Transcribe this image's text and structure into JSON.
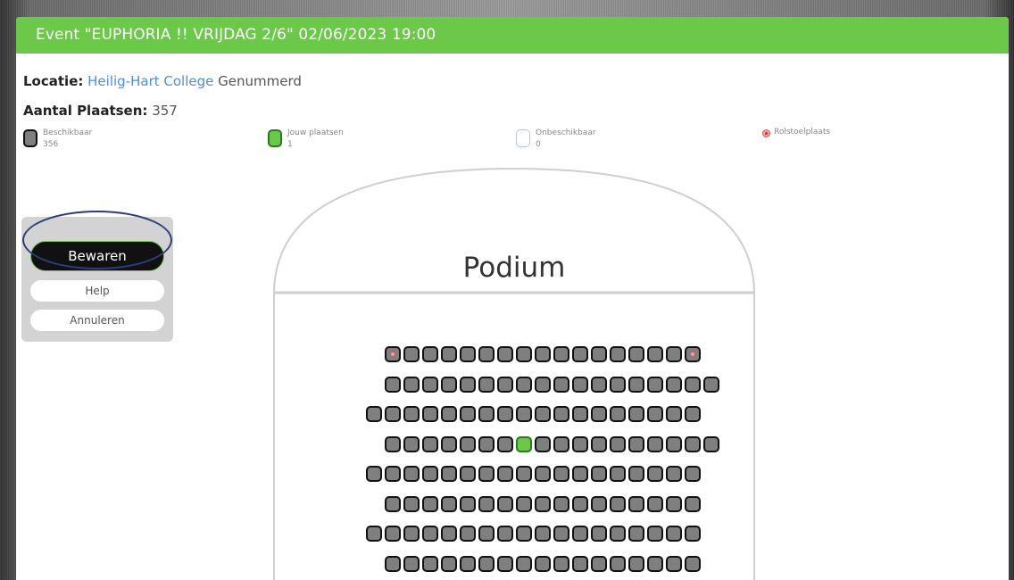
{
  "window": {
    "title": "Event \"EUPHORIA !! VRIJDAG 2/6\" 02/06/2023 19:00"
  },
  "info": {
    "locatie_label": "Locatie:",
    "locatie_link": "Heilig-Hart College",
    "locatie_suffix": "Genummerd",
    "plaatsen_label": "Aantal Plaatsen:",
    "plaatsen_value": "357"
  },
  "legend": {
    "beschikbaar": {
      "label": "Beschikbaar",
      "count": "356",
      "color": "#7f7f7f"
    },
    "jouw": {
      "label": "Jouw plaatsen",
      "count": "1",
      "color": "#6bc849"
    },
    "onbeschikbaar": {
      "label": "Onbeschikbaar",
      "count": "0",
      "color": "#ffffff"
    },
    "rolstoel": {
      "label": "Rolstoelplaats",
      "color": "#d9534f"
    }
  },
  "panel": {
    "bewaren": "Bewaren",
    "help": "Help",
    "annuleren": "Annuleren"
  },
  "stage": {
    "label": "Podium"
  },
  "seating": {
    "rows": [
      {
        "seats": 17,
        "wheelchair": [
          0,
          16
        ]
      },
      {
        "seats": 18
      },
      {
        "seats": 18
      },
      {
        "seats": 18,
        "mine": [
          7
        ]
      },
      {
        "seats": 18
      },
      {
        "seats": 17
      },
      {
        "seats": 18
      },
      {
        "seats": 17
      }
    ]
  }
}
